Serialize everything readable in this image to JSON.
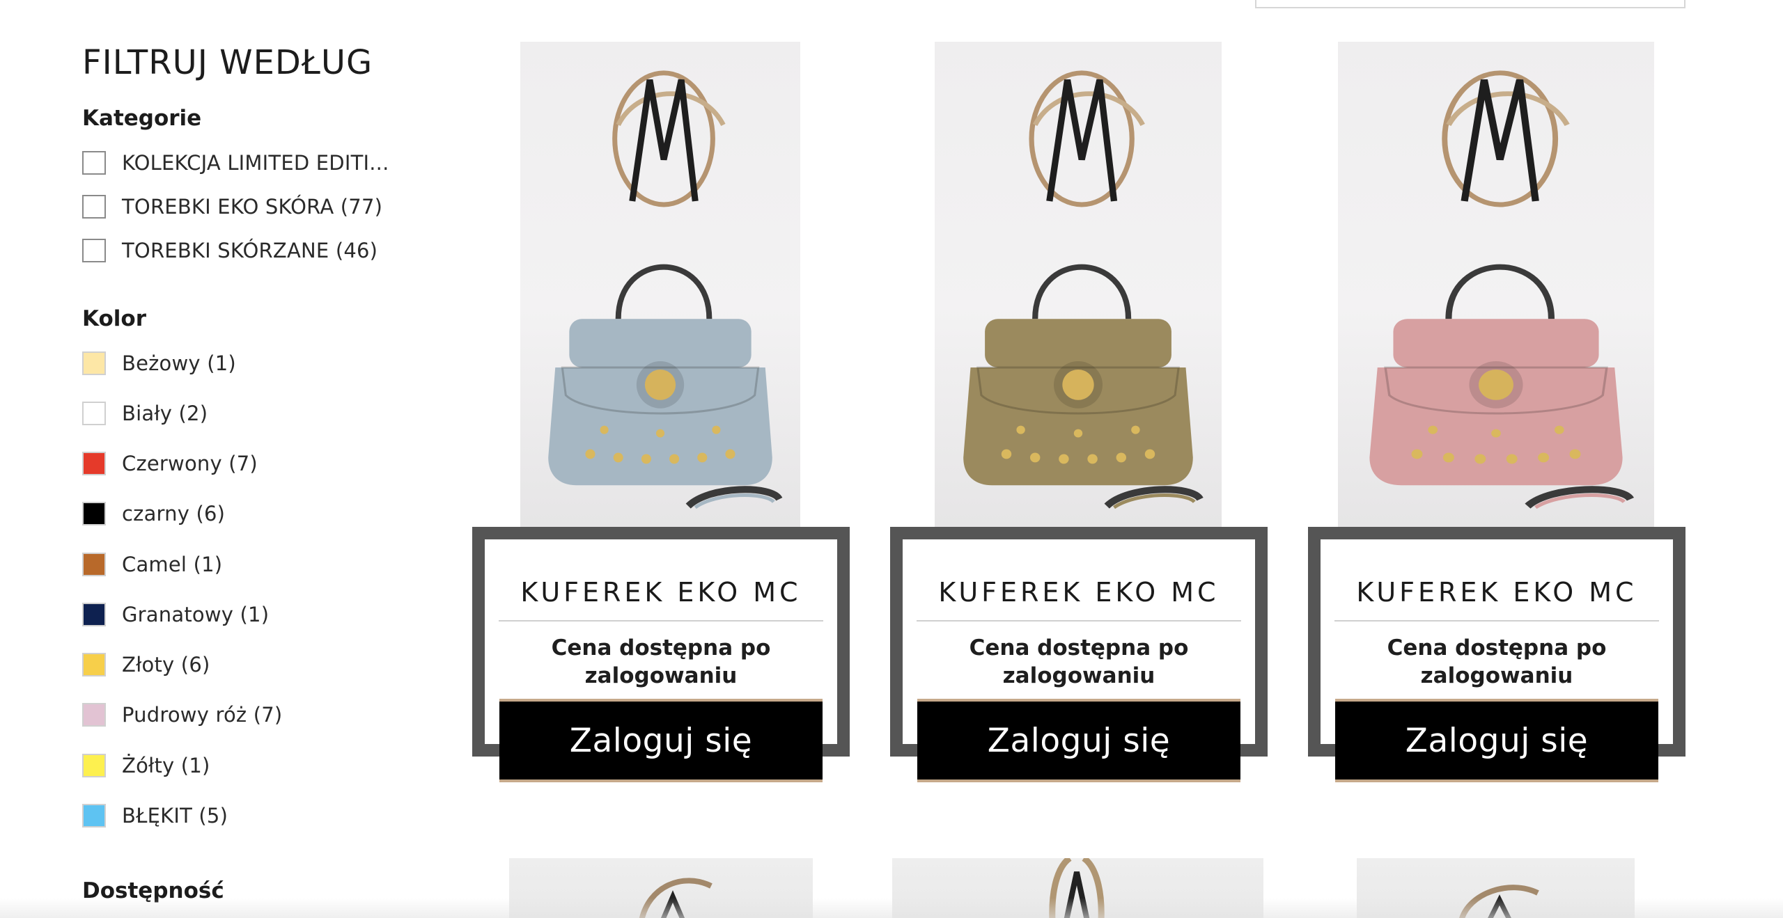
{
  "sidebar": {
    "title": "FILTRUJ WEDŁUG",
    "categories": {
      "title": "Kategorie",
      "items": [
        {
          "label": "KOLEKCJA LIMITED EDITI..."
        },
        {
          "label": "TOREBKI EKO SKÓRA (77)"
        },
        {
          "label": "TOREBKI SKÓRZANE (46)"
        }
      ]
    },
    "color": {
      "title": "Kolor",
      "items": [
        {
          "label": "Beżowy (1)",
          "swatch": "#fde7a6"
        },
        {
          "label": "Biały (2)",
          "swatch": "#ffffff"
        },
        {
          "label": "Czerwony (7)",
          "swatch": "#e53a2a"
        },
        {
          "label": "czarny (6)",
          "swatch": "#000000"
        },
        {
          "label": "Camel (1)",
          "swatch": "#b8692a"
        },
        {
          "label": "Granatowy (1)",
          "swatch": "#0e2150"
        },
        {
          "label": "Złoty (6)",
          "swatch": "#f7cf4a"
        },
        {
          "label": "Pudrowy róż (7)",
          "swatch": "#e2c3d3"
        },
        {
          "label": "Żółty (1)",
          "swatch": "#fdf04f"
        },
        {
          "label": "BŁĘKIT (5)",
          "swatch": "#5ec3f2"
        }
      ]
    },
    "availability": {
      "title": "Dostępność"
    }
  },
  "products": [
    {
      "title": "KUFEREK EKO MC",
      "price": "Cena dostępna po zalogowaniu",
      "button": "Zaloguj się",
      "bag_color": "#a6b7c3"
    },
    {
      "title": "KUFEREK EKO MC",
      "price": "Cena dostępna po zalogowaniu",
      "button": "Zaloguj się",
      "bag_color": "#9b8a5e"
    },
    {
      "title": "KUFEREK EKO MC",
      "price": "Cena dostępna po zalogowaniu",
      "button": "Zaloguj się",
      "bag_color": "#d7a0a1"
    }
  ],
  "colors": {
    "frame": "#555555",
    "button_bg": "#000000",
    "button_accent": "#c6a98a"
  }
}
